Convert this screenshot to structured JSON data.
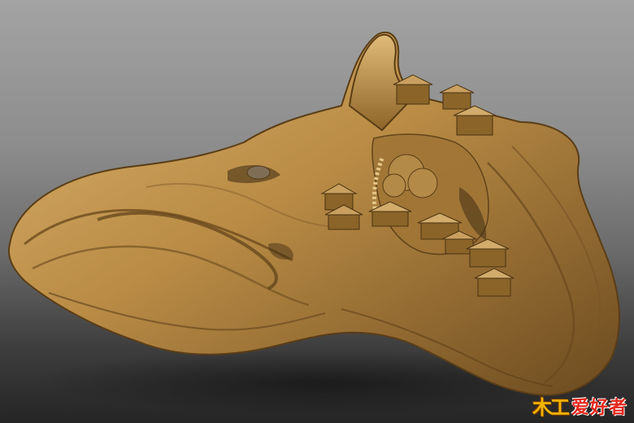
{
  "image": {
    "subject": "carved-driftwood-root-sculpture",
    "colors": {
      "wood_light": "#d9b06a",
      "wood_mid": "#b0823e",
      "wood_dark": "#6b4a1f",
      "background_top": "#a3a3a3",
      "background_bottom": "#252525"
    }
  },
  "watermark": {
    "left_text": "木工",
    "right_text": "爱好者",
    "left_color": "#f2b500",
    "right_color": "#e4261a"
  }
}
